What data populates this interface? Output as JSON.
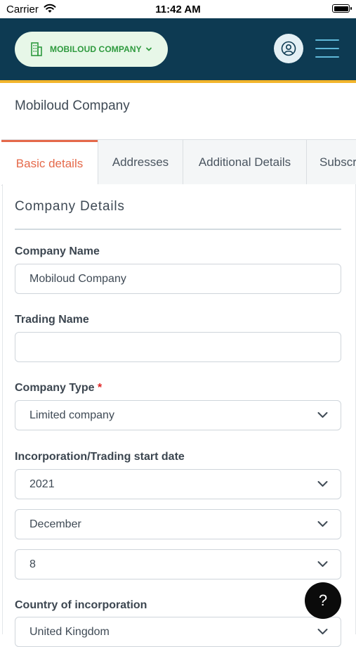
{
  "status_bar": {
    "carrier": "Carrier",
    "time": "11:42 AM"
  },
  "header": {
    "company_switch_label": "MOBILOUD COMPANY"
  },
  "page": {
    "title": "Mobiloud Company"
  },
  "tabs": [
    {
      "label": "Basic details",
      "active": true
    },
    {
      "label": "Addresses",
      "active": false
    },
    {
      "label": "Additional Details",
      "active": false
    },
    {
      "label": "Subscri",
      "active": false
    }
  ],
  "section": {
    "title": "Company Details"
  },
  "form": {
    "company_name": {
      "label": "Company Name",
      "value": "Mobiloud Company"
    },
    "trading_name": {
      "label": "Trading Name",
      "value": ""
    },
    "company_type": {
      "label": "Company Type",
      "required_mark": "*",
      "value": "Limited company"
    },
    "incorporation_date": {
      "label": "Incorporation/Trading start date",
      "year": "2021",
      "month": "December",
      "day": "8"
    },
    "country": {
      "label": "Country of incorporation",
      "value": "United Kingdom"
    }
  },
  "help": {
    "label": "?"
  },
  "colors": {
    "header_bg": "#0d3a52",
    "accent_border": "#f2b52c",
    "active_tab": "#e5694a",
    "company_chip_text": "#2e9a3e"
  }
}
